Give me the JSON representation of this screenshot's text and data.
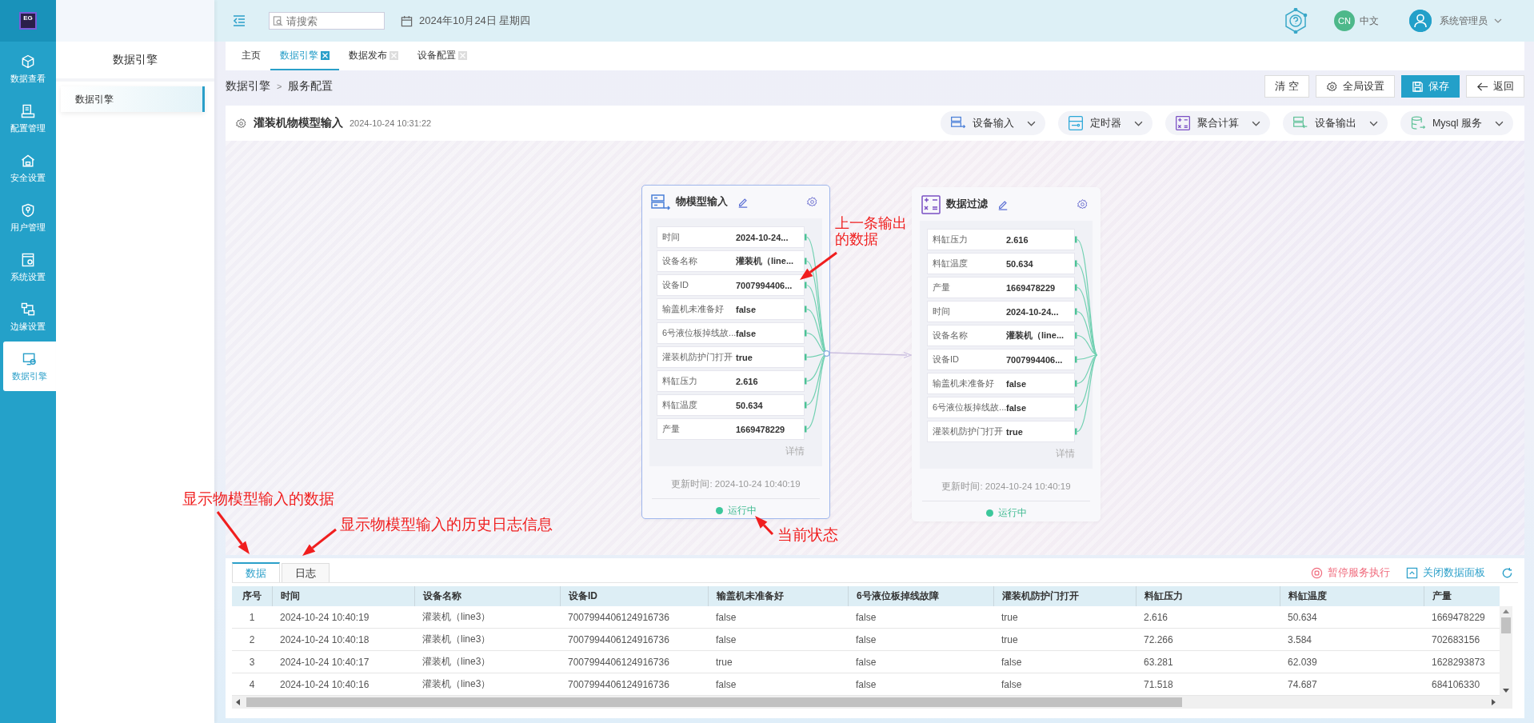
{
  "nav": {
    "logo": "EG",
    "items": [
      {
        "label": "数据查看",
        "selected": false
      },
      {
        "label": "配置管理",
        "selected": false
      },
      {
        "label": "安全设置",
        "selected": false
      },
      {
        "label": "用户管理",
        "selected": false
      },
      {
        "label": "系统设置",
        "selected": false
      },
      {
        "label": "边缘设置",
        "selected": false
      },
      {
        "label": "数据引擎",
        "selected": true
      }
    ]
  },
  "sidebar": {
    "title": "数据引擎",
    "items": [
      {
        "label": "数据引擎",
        "selected": true
      }
    ]
  },
  "header": {
    "search": {
      "placeholder": "请搜索"
    },
    "date": "2024年10月24日 星期四",
    "language": {
      "badge": "CN",
      "label": "中文"
    },
    "user": "系统管理员"
  },
  "tabs": [
    {
      "label": "主页",
      "closable": false,
      "selected": false
    },
    {
      "label": "数据引擎",
      "closable": true,
      "selected": true
    },
    {
      "label": "数据发布",
      "closable": true,
      "selected": false
    },
    {
      "label": "设备配置",
      "closable": true,
      "selected": false
    }
  ],
  "breadcrumb": {
    "items": [
      "数据引擎",
      "服务配置"
    ],
    "separator": ">"
  },
  "toolbar_buttons": [
    {
      "label": "清 空",
      "kind": "plain"
    },
    {
      "label": "全局设置",
      "kind": "settings"
    },
    {
      "label": "保存",
      "kind": "primary"
    },
    {
      "label": "返回",
      "kind": "back"
    }
  ],
  "flow": {
    "title": "灌装机物模型输入",
    "timestamp": "2024-10-24 10:31:22",
    "components": [
      "设备输入",
      "定时器",
      "聚合计算",
      "设备输出",
      "Mysql 服务"
    ],
    "nodes": [
      {
        "title": "物模型输入",
        "selected": true,
        "fields": [
          {
            "label": "时间",
            "value": "2024-10-24..."
          },
          {
            "label": "设备名称",
            "value": "灌装机（line..."
          },
          {
            "label": "设备ID",
            "value": "7007994406..."
          },
          {
            "label": "输盖机未准备好",
            "value": "false"
          },
          {
            "label": "6号液位板掉线故...",
            "value": "false"
          },
          {
            "label": "灌装机防护门打开",
            "value": "true"
          },
          {
            "label": "料缸压力",
            "value": "2.616"
          },
          {
            "label": "料缸温度",
            "value": "50.634"
          },
          {
            "label": "产量",
            "value": "1669478229"
          }
        ],
        "detail": "详情",
        "updated": "更新时间: 2024-10-24 10:40:19",
        "status": "运行中"
      },
      {
        "title": "数据过滤",
        "selected": false,
        "fields": [
          {
            "label": "料缸压力",
            "value": "2.616"
          },
          {
            "label": "料缸温度",
            "value": "50.634"
          },
          {
            "label": "产量",
            "value": "1669478229"
          },
          {
            "label": "时间",
            "value": "2024-10-24..."
          },
          {
            "label": "设备名称",
            "value": "灌装机（line..."
          },
          {
            "label": "设备ID",
            "value": "7007994406..."
          },
          {
            "label": "输盖机未准备好",
            "value": "false"
          },
          {
            "label": "6号液位板掉线故...",
            "value": "false"
          },
          {
            "label": "灌装机防护门打开",
            "value": "true"
          }
        ],
        "detail": "详情",
        "updated": "更新时间: 2024-10-24 10:40:19",
        "status": "运行中"
      }
    ]
  },
  "data_panel": {
    "tabs": [
      {
        "label": "数据",
        "selected": true
      },
      {
        "label": "日志",
        "selected": false
      }
    ],
    "actions": [
      {
        "label": "暂停服务执行",
        "kind": "danger"
      },
      {
        "label": "关闭数据面板",
        "kind": "normal"
      }
    ],
    "table": {
      "columns": [
        "序号",
        "时间",
        "设备名称",
        "设备ID",
        "输盖机未准备好",
        "6号液位板掉线故障",
        "灌装机防护门打开",
        "料缸压力",
        "料缸温度",
        "产量"
      ],
      "rows": [
        [
          "1",
          "2024-10-24 10:40:19",
          "灌装机（line3）",
          "7007994406124916736",
          "false",
          "false",
          "true",
          "2.616",
          "50.634",
          "1669478229"
        ],
        [
          "2",
          "2024-10-24 10:40:18",
          "灌装机（line3）",
          "7007994406124916736",
          "false",
          "false",
          "true",
          "72.266",
          "3.584",
          "702683156"
        ],
        [
          "3",
          "2024-10-24 10:40:17",
          "灌装机（line3）",
          "7007994406124916736",
          "true",
          "false",
          "false",
          "63.281",
          "62.039",
          "1628293873"
        ],
        [
          "4",
          "2024-10-24 10:40:16",
          "灌装机（line3）",
          "7007994406124916736",
          "false",
          "false",
          "false",
          "71.518",
          "74.687",
          "684106330"
        ]
      ]
    }
  },
  "annotations": [
    "上一条输出的数据",
    "当前状态",
    "显示物模型输入的数据",
    "显示物模型输入的历史日志信息"
  ]
}
